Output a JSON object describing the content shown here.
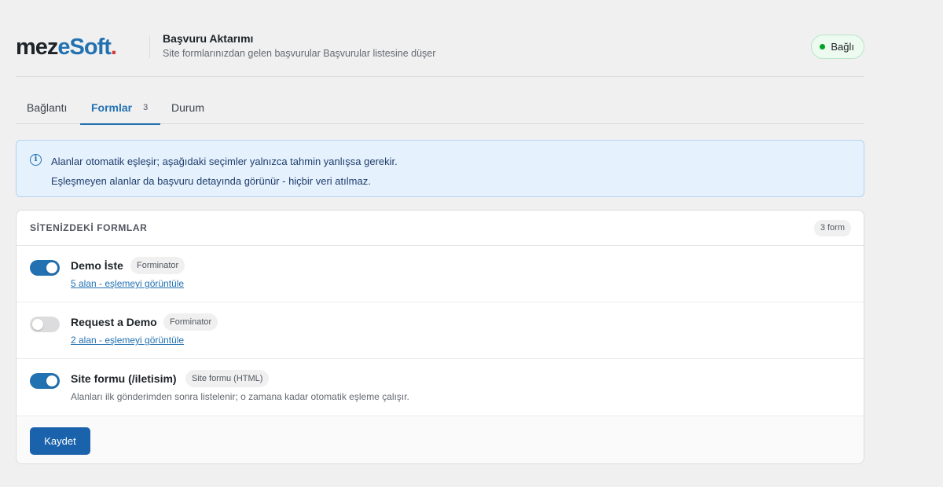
{
  "brand": {
    "logo_part1": "mez",
    "logo_part2": "eSoft",
    "logo_part3": "."
  },
  "header": {
    "title": "Başvuru Aktarımı",
    "subtitle": "Site formlarınızdan gelen başvurular Başvurular listesine düşer",
    "status": "Bağlı",
    "status_color": "#00a32a"
  },
  "tabs": [
    {
      "label": "Bağlantı"
    },
    {
      "label": "Formlar",
      "count": "3",
      "active": true
    },
    {
      "label": "Durum"
    }
  ],
  "notice": {
    "icon": "info-icon",
    "line1": "Alanlar otomatik eşleşir; aşağıdaki seçimler yalnızca tahmin yanlışsa gerekir.",
    "line2": "Eşleşmeyen alanlar da başvuru detayında görünür - hiçbir veri atılmaz."
  },
  "forms_card": {
    "title": "SİTENİZDEKİ FORMLAR",
    "count_badge": "3 form",
    "forms": [
      {
        "name": "Demo İste",
        "source": "Forminator",
        "enabled": true,
        "link": "5 alan - eşlemeyi görüntüle"
      },
      {
        "name": "Request a Demo",
        "source": "Forminator",
        "enabled": false,
        "link": "2 alan - eşlemeyi görüntüle"
      },
      {
        "name": "Site formu (/iletisim)",
        "source": "Site formu (HTML)",
        "enabled": true,
        "hint": "Alanları ilk gönderimden sonra listelenir; o zamana kadar otomatik eşleme çalışır."
      }
    ],
    "save_label": "Kaydet"
  },
  "colors": {
    "accent": "#2271b1",
    "button": "#1b62ad",
    "notice_bg": "#e5f1fd"
  }
}
